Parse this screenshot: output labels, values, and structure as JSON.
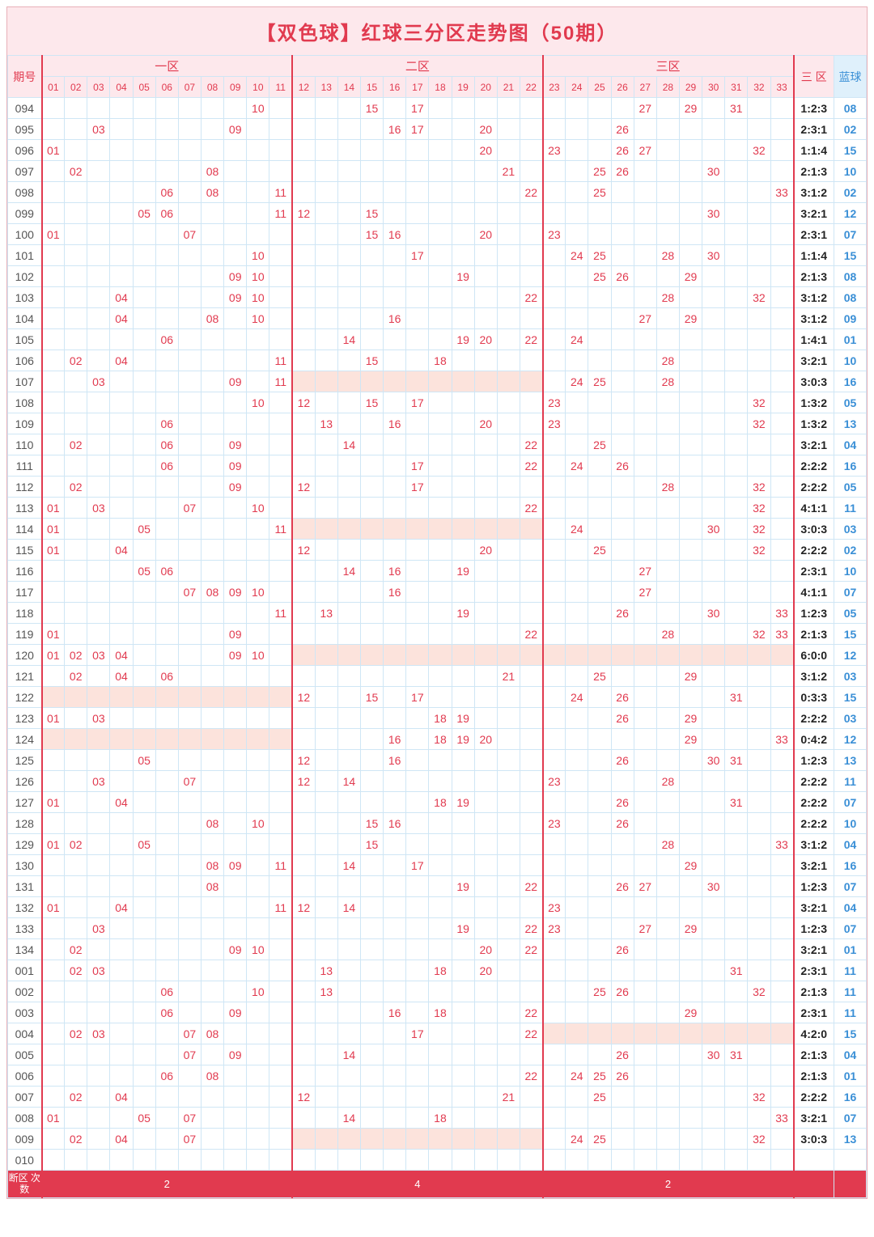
{
  "title": "【双色球】红球三分区走势图（50期）",
  "headers": {
    "period": "期号",
    "zones": [
      "一区",
      "二区",
      "三区"
    ],
    "ratio": "三\n区",
    "blue": "蓝球",
    "nums": [
      "01",
      "02",
      "03",
      "04",
      "05",
      "06",
      "07",
      "08",
      "09",
      "10",
      "11",
      "12",
      "13",
      "14",
      "15",
      "16",
      "17",
      "18",
      "19",
      "20",
      "21",
      "22",
      "23",
      "24",
      "25",
      "26",
      "27",
      "28",
      "29",
      "30",
      "31",
      "32",
      "33"
    ]
  },
  "footer": {
    "label": "断区\n次数",
    "z1": "2",
    "z2": "4",
    "z3": "2"
  },
  "chart_data": {
    "type": "table",
    "title": "双色球红球三分区走势图（50期）",
    "zone_boundaries": [
      11,
      22,
      33
    ],
    "rows": [
      {
        "p": "094",
        "r": [
          10,
          15,
          17,
          27,
          29,
          31
        ],
        "ratio": "1:2:3",
        "b": "08"
      },
      {
        "p": "095",
        "r": [
          3,
          9,
          16,
          17,
          20,
          26
        ],
        "ratio": "2:3:1",
        "b": "02"
      },
      {
        "p": "096",
        "r": [
          1,
          20,
          23,
          26,
          27,
          32
        ],
        "ratio": "1:1:4",
        "b": "15"
      },
      {
        "p": "097",
        "r": [
          2,
          8,
          21,
          25,
          26,
          30
        ],
        "ratio": "2:1:3",
        "b": "10"
      },
      {
        "p": "098",
        "r": [
          6,
          8,
          11,
          22,
          25,
          33
        ],
        "ratio": "3:1:2",
        "b": "02"
      },
      {
        "p": "099",
        "r": [
          5,
          6,
          11,
          12,
          15,
          30
        ],
        "ratio": "3:2:1",
        "b": "12"
      },
      {
        "p": "100",
        "r": [
          1,
          7,
          15,
          16,
          20,
          23
        ],
        "ratio": "2:3:1",
        "b": "07"
      },
      {
        "p": "101",
        "r": [
          10,
          17,
          24,
          25,
          28,
          30
        ],
        "ratio": "1:1:4",
        "b": "15"
      },
      {
        "p": "102",
        "r": [
          9,
          10,
          19,
          25,
          26,
          29
        ],
        "ratio": "2:1:3",
        "b": "08"
      },
      {
        "p": "103",
        "r": [
          4,
          9,
          10,
          22,
          28,
          32
        ],
        "ratio": "3:1:2",
        "b": "08"
      },
      {
        "p": "104",
        "r": [
          4,
          8,
          10,
          16,
          27,
          29
        ],
        "ratio": "3:1:2",
        "b": "09"
      },
      {
        "p": "105",
        "r": [
          6,
          14,
          19,
          20,
          22,
          24
        ],
        "ratio": "1:4:1",
        "b": "01"
      },
      {
        "p": "106",
        "r": [
          2,
          4,
          11,
          15,
          18,
          28
        ],
        "ratio": "3:2:1",
        "b": "10"
      },
      {
        "p": "107",
        "r": [
          3,
          9,
          11,
          24,
          25,
          28
        ],
        "ratio": "3:0:3",
        "b": "16"
      },
      {
        "p": "108",
        "r": [
          10,
          12,
          15,
          17,
          23,
          32
        ],
        "ratio": "1:3:2",
        "b": "05"
      },
      {
        "p": "109",
        "r": [
          6,
          13,
          16,
          20,
          23,
          32
        ],
        "ratio": "1:3:2",
        "b": "13"
      },
      {
        "p": "110",
        "r": [
          2,
          6,
          9,
          14,
          22,
          25
        ],
        "ratio": "3:2:1",
        "b": "04"
      },
      {
        "p": "111",
        "r": [
          6,
          9,
          17,
          22,
          24,
          26
        ],
        "ratio": "2:2:2",
        "b": "16"
      },
      {
        "p": "112",
        "r": [
          2,
          9,
          12,
          17,
          28,
          32
        ],
        "ratio": "2:2:2",
        "b": "05"
      },
      {
        "p": "113",
        "r": [
          1,
          3,
          7,
          10,
          22,
          32
        ],
        "ratio": "4:1:1",
        "b": "11"
      },
      {
        "p": "114",
        "r": [
          1,
          5,
          11,
          24,
          30,
          32
        ],
        "ratio": "3:0:3",
        "b": "03"
      },
      {
        "p": "115",
        "r": [
          1,
          4,
          12,
          20,
          25,
          32
        ],
        "ratio": "2:2:2",
        "b": "02"
      },
      {
        "p": "116",
        "r": [
          5,
          6,
          14,
          16,
          19,
          27
        ],
        "ratio": "2:3:1",
        "b": "10"
      },
      {
        "p": "117",
        "r": [
          7,
          8,
          9,
          10,
          16,
          27
        ],
        "ratio": "4:1:1",
        "b": "07"
      },
      {
        "p": "118",
        "r": [
          11,
          13,
          19,
          26,
          30,
          33
        ],
        "ratio": "1:2:3",
        "b": "05"
      },
      {
        "p": "119",
        "r": [
          1,
          9,
          22,
          28,
          32,
          33
        ],
        "ratio": "2:1:3",
        "b": "15"
      },
      {
        "p": "120",
        "r": [
          1,
          2,
          3,
          4,
          9,
          10
        ],
        "ratio": "6:0:0",
        "b": "12"
      },
      {
        "p": "121",
        "r": [
          2,
          4,
          6,
          21,
          25,
          29
        ],
        "ratio": "3:1:2",
        "b": "03"
      },
      {
        "p": "122",
        "r": [
          12,
          15,
          17,
          24,
          26,
          31
        ],
        "ratio": "0:3:3",
        "b": "15"
      },
      {
        "p": "123",
        "r": [
          1,
          3,
          18,
          19,
          26,
          29
        ],
        "ratio": "2:2:2",
        "b": "03"
      },
      {
        "p": "124",
        "r": [
          16,
          18,
          19,
          20,
          29,
          33
        ],
        "ratio": "0:4:2",
        "b": "12"
      },
      {
        "p": "125",
        "r": [
          5,
          12,
          16,
          26,
          30,
          31
        ],
        "ratio": "1:2:3",
        "b": "13"
      },
      {
        "p": "126",
        "r": [
          3,
          7,
          12,
          14,
          23,
          28
        ],
        "ratio": "2:2:2",
        "b": "11"
      },
      {
        "p": "127",
        "r": [
          1,
          4,
          18,
          19,
          26,
          31
        ],
        "ratio": "2:2:2",
        "b": "07"
      },
      {
        "p": "128",
        "r": [
          8,
          10,
          15,
          16,
          23,
          26
        ],
        "ratio": "2:2:2",
        "b": "10"
      },
      {
        "p": "129",
        "r": [
          1,
          2,
          5,
          15,
          28,
          33
        ],
        "ratio": "3:1:2",
        "b": "04"
      },
      {
        "p": "130",
        "r": [
          8,
          9,
          11,
          14,
          17,
          29
        ],
        "ratio": "3:2:1",
        "b": "16"
      },
      {
        "p": "131",
        "r": [
          8,
          19,
          22,
          26,
          27,
          30
        ],
        "ratio": "1:2:3",
        "b": "07"
      },
      {
        "p": "132",
        "r": [
          1,
          4,
          11,
          12,
          14,
          23
        ],
        "ratio": "3:2:1",
        "b": "04"
      },
      {
        "p": "133",
        "r": [
          3,
          19,
          22,
          23,
          27,
          29
        ],
        "ratio": "1:2:3",
        "b": "07"
      },
      {
        "p": "134",
        "r": [
          2,
          9,
          10,
          20,
          22,
          26
        ],
        "ratio": "3:2:1",
        "b": "01"
      },
      {
        "p": "001",
        "r": [
          2,
          3,
          13,
          18,
          20,
          31
        ],
        "ratio": "2:3:1",
        "b": "11"
      },
      {
        "p": "002",
        "r": [
          6,
          10,
          13,
          25,
          26,
          32
        ],
        "ratio": "2:1:3",
        "b": "11"
      },
      {
        "p": "003",
        "r": [
          6,
          9,
          16,
          18,
          22,
          29
        ],
        "ratio": "2:3:1",
        "b": "11"
      },
      {
        "p": "004",
        "r": [
          2,
          3,
          7,
          8,
          17,
          22
        ],
        "ratio": "4:2:0",
        "b": "15"
      },
      {
        "p": "005",
        "r": [
          7,
          9,
          14,
          26,
          30,
          31
        ],
        "ratio": "2:1:3",
        "b": "04"
      },
      {
        "p": "006",
        "r": [
          6,
          8,
          22,
          24,
          25,
          26
        ],
        "ratio": "2:1:3",
        "b": "01"
      },
      {
        "p": "007",
        "r": [
          2,
          4,
          12,
          21,
          25,
          32
        ],
        "ratio": "2:2:2",
        "b": "16"
      },
      {
        "p": "008",
        "r": [
          1,
          5,
          7,
          14,
          18,
          33
        ],
        "ratio": "3:2:1",
        "b": "07"
      },
      {
        "p": "009",
        "r": [
          2,
          4,
          7,
          24,
          25,
          32
        ],
        "ratio": "3:0:3",
        "b": "13"
      },
      {
        "p": "010",
        "r": [],
        "ratio": "",
        "b": ""
      }
    ]
  }
}
